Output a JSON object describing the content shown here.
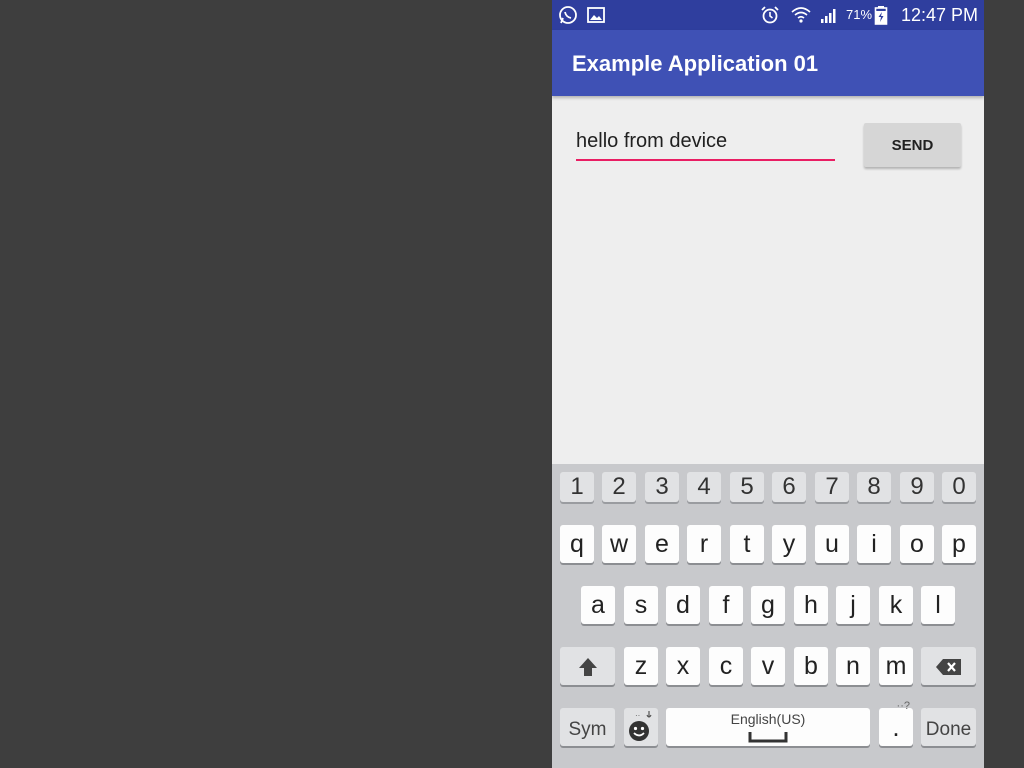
{
  "status_bar": {
    "icons_left": [
      "whatsapp-icon",
      "gallery-icon"
    ],
    "icons_right": [
      "alarm-icon",
      "wifi-icon",
      "signal-icon",
      "battery-charging-icon"
    ],
    "battery_percent": "71%",
    "time": "12:47 PM"
  },
  "app_bar": {
    "title": "Example Application 01"
  },
  "main": {
    "message_input": {
      "value": "hello from device"
    },
    "send_button": {
      "label": "SEND"
    }
  },
  "keyboard": {
    "number_row": [
      "1",
      "2",
      "3",
      "4",
      "5",
      "6",
      "7",
      "8",
      "9",
      "0"
    ],
    "row1": [
      "q",
      "w",
      "e",
      "r",
      "t",
      "y",
      "u",
      "i",
      "o",
      "p"
    ],
    "row2": [
      "a",
      "s",
      "d",
      "f",
      "g",
      "h",
      "j",
      "k",
      "l"
    ],
    "row3": [
      "z",
      "x",
      "c",
      "v",
      "b",
      "n",
      "m"
    ],
    "sym_label": "Sym",
    "space_label": "English(US)",
    "period_label": ".",
    "period_hint": "··?",
    "done_label": "Done"
  },
  "colors": {
    "status_bar": "#2f3e9e",
    "app_bar": "#3f51b5",
    "input_underline": "#e91e63",
    "background": "#eeeeee",
    "keyboard": "#c8c9cc"
  }
}
